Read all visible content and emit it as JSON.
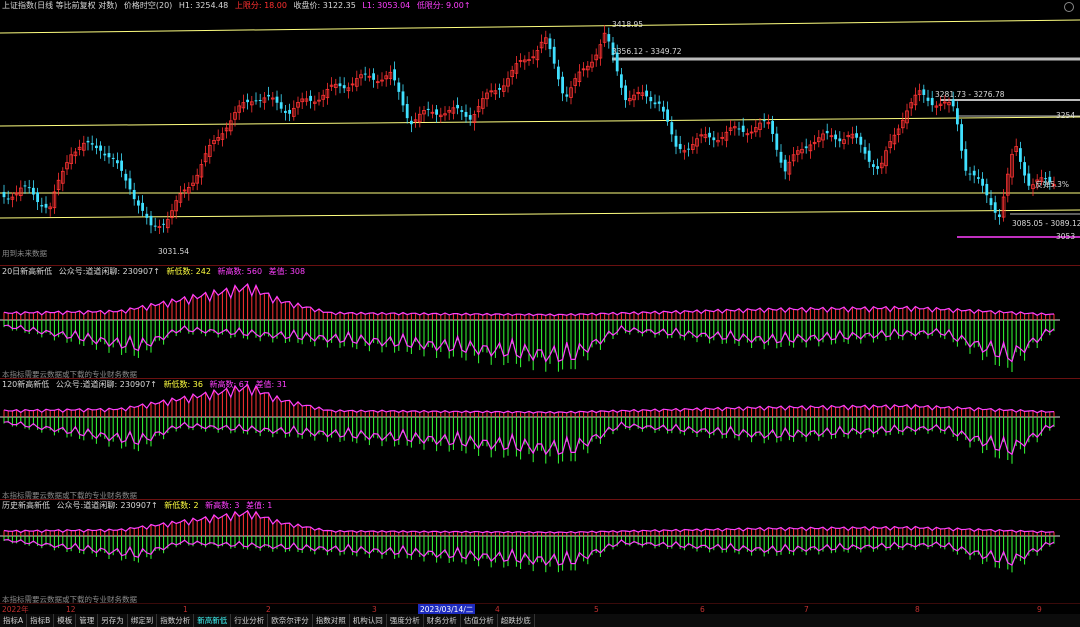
{
  "main": {
    "header": {
      "index": "上证指数(日线 等比前复权 对数)",
      "indicator": "价格时空(20)",
      "h1": "H1: 3254.48",
      "upper": "上限分: 18.00",
      "close": "收盘价: 3122.35",
      "l1": "L1: 3053.04",
      "lower": "低限分: 9.00↑"
    },
    "labels": {
      "high": "3418.95",
      "r1": "3356.12 - 3349.72",
      "r2": "3281.73 - 3276.78",
      "h1v": "3254",
      "low_left": "3031.54",
      "s1": "3085.05 - 3089.12",
      "l1v": "3053",
      "pct": "反弹5.3%"
    },
    "note": "用到未来数据"
  },
  "panels": [
    {
      "title": "20日新高新低",
      "sub": "公众号:道道闲聊: 230907↑",
      "a": "新低数: 242",
      "b": "新高数: 560",
      "c": "差值: 308",
      "note": "本指标需要云数据或下载的专业财务数据"
    },
    {
      "title": "120新高新低",
      "sub": "公众号:道道闲聊: 230907↑",
      "a": "新低数: 36",
      "b": "新高数: 67",
      "c": "差值: 31",
      "note": "本指标需要云数据或下载的专业财务数据"
    },
    {
      "title": "历史新高新低",
      "sub": "公众号:道道闲聊: 230907↑",
      "a": "新低数: 2",
      "b": "新高数: 3",
      "c": "差值: 1",
      "note": "本指标需要云数据或下载的专业财务数据"
    }
  ],
  "axis": {
    "ticks": [
      "2022年",
      "12",
      "1",
      "2",
      "3",
      "4",
      "5",
      "6",
      "7",
      "8",
      "9"
    ],
    "highlight": "2023/03/14/二"
  },
  "tabs": [
    "指标A",
    "指标B",
    "模板",
    "管理",
    "另存为",
    "绑定到",
    "指数分析",
    "新高新低",
    "行业分析",
    "欧奈尔评分",
    "指数对照",
    "机构认同",
    "强度分析",
    "财务分析",
    "估值分析",
    "超跌抄底"
  ],
  "active_tab": "新高新低",
  "colors": {
    "up": "#ff3333",
    "down": "#40e0ff",
    "line": "#ffff80",
    "magenta": "#ff40ff",
    "green": "#33ff33"
  }
}
